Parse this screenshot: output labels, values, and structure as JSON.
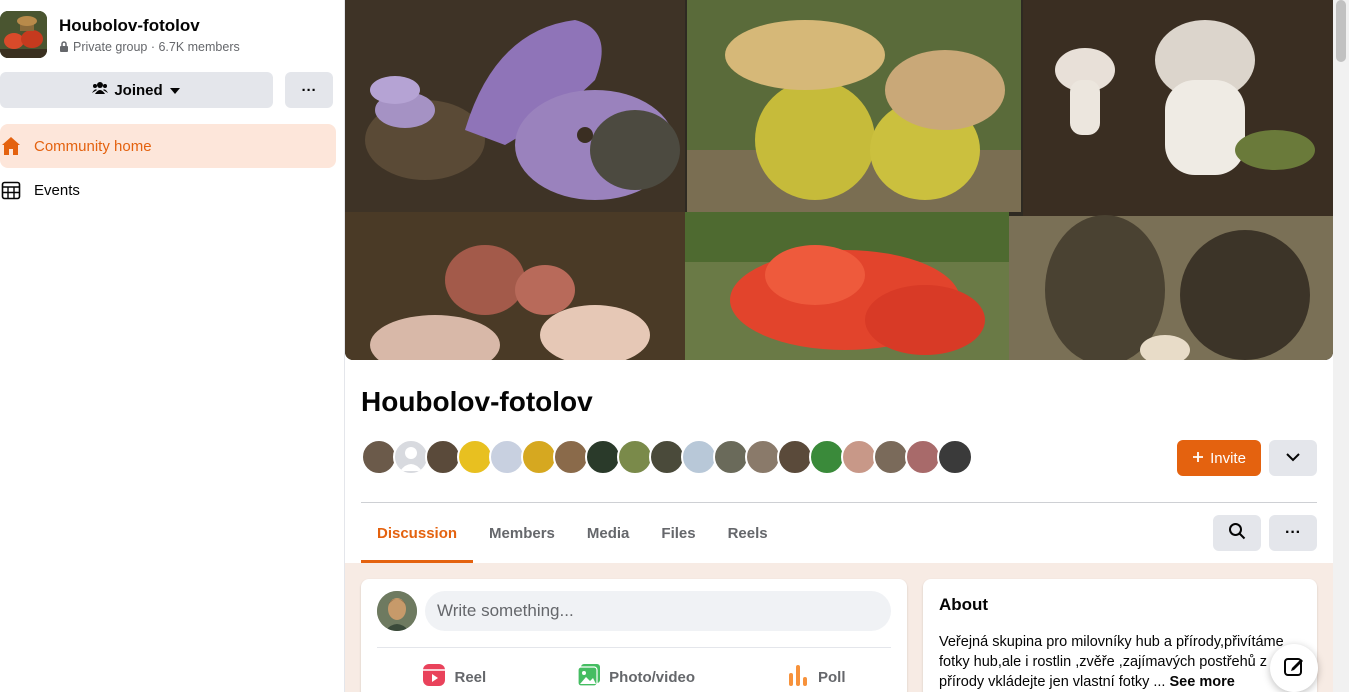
{
  "sidebar": {
    "group_name": "Houbolov-fotolov",
    "group_meta": "Private group · 6.7K members",
    "joined_label": "Joined",
    "more_label": "···",
    "nav": [
      {
        "label": "Community home",
        "icon": "home-icon",
        "active": true
      },
      {
        "label": "Events",
        "icon": "calendar-icon",
        "active": false
      }
    ]
  },
  "header": {
    "title": "Houbolov-fotolov",
    "invite_label": "Invite",
    "member_avatars_count": 19
  },
  "tabs": [
    {
      "label": "Discussion",
      "active": true
    },
    {
      "label": "Members",
      "active": false
    },
    {
      "label": "Media",
      "active": false
    },
    {
      "label": "Files",
      "active": false
    },
    {
      "label": "Reels",
      "active": false
    }
  ],
  "tab_more_label": "···",
  "composer": {
    "placeholder": "Write something...",
    "actions": [
      {
        "label": "Reel",
        "icon": "reel-icon"
      },
      {
        "label": "Photo/video",
        "icon": "photo-icon"
      },
      {
        "label": "Poll",
        "icon": "poll-icon"
      }
    ]
  },
  "about": {
    "heading": "About",
    "text": "Veřejná skupina pro milovníky hub a přírody,přivítáme fotky hub,ale i rostlin ,zvěře ,zajímavých postřehů z přírody vkládejte jen vlastní fotky ...",
    "see_more": "See more"
  },
  "colors": {
    "accent": "#e4620f",
    "active_bg": "#fde6da",
    "button_bg": "#e4e6eb",
    "feed_bg": "#f7ebe4"
  }
}
